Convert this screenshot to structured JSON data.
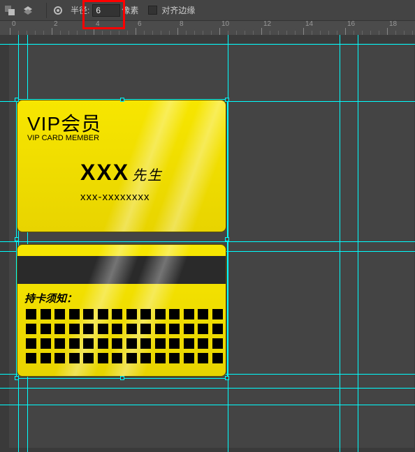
{
  "toolbar": {
    "radius_label": "半径:",
    "radius_value": "6",
    "radius_unit": "像素",
    "align_label": "对齐边缘"
  },
  "ruler": {
    "marks": [
      "0",
      "2",
      "4",
      "6",
      "8",
      "10",
      "12",
      "14",
      "16",
      "18"
    ]
  },
  "card_front": {
    "title": "VIP会员",
    "subtitle": "VIP CARD MEMBER",
    "name": "XXX",
    "name_suffix": "先生",
    "code": "xxx-xxxxxxxx"
  },
  "card_back": {
    "notice": "持卡须知：",
    "grid_rows": 4,
    "grid_cols": 14
  }
}
